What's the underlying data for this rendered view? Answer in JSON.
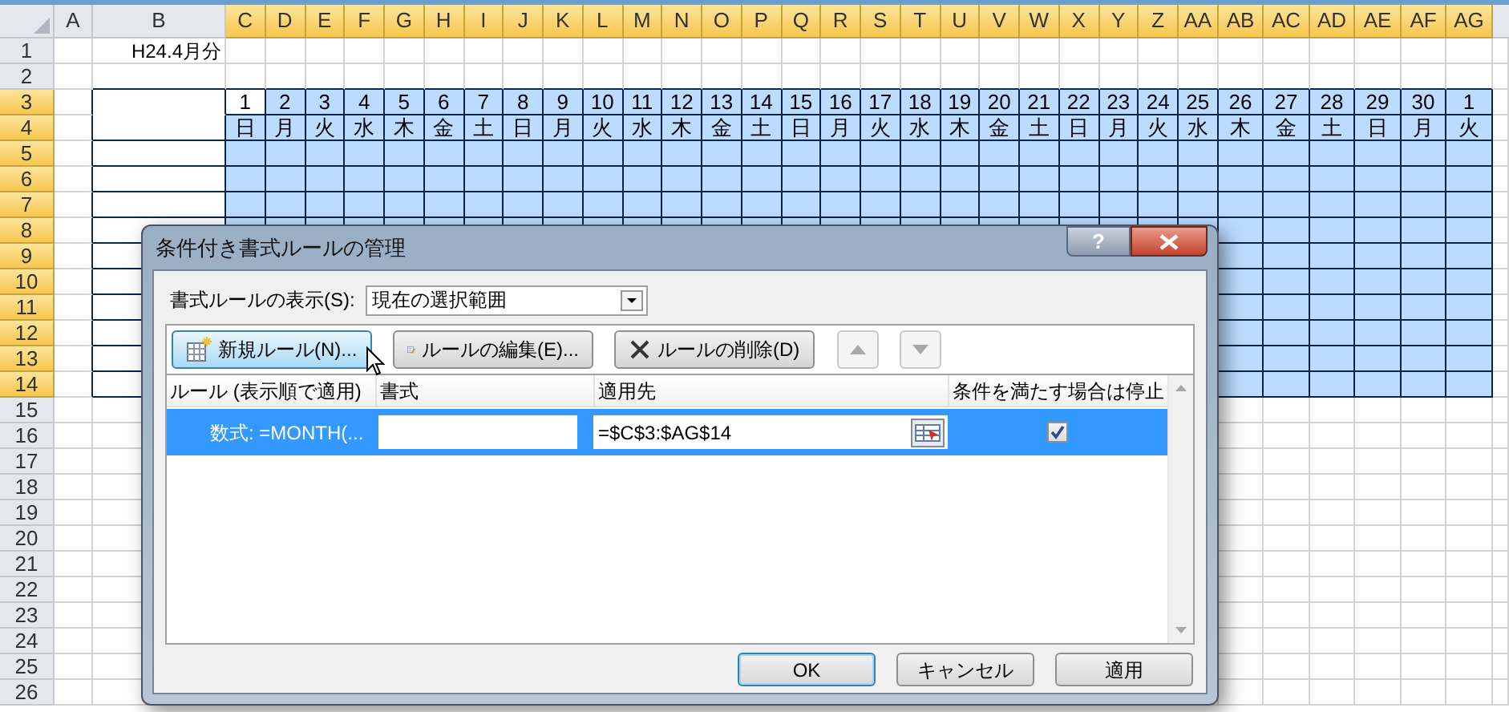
{
  "sheet": {
    "columns": [
      {
        "label": "A",
        "selected": false
      },
      {
        "label": "B",
        "selected": false
      },
      {
        "label": "C",
        "selected": true
      },
      {
        "label": "D",
        "selected": true
      },
      {
        "label": "E",
        "selected": true
      },
      {
        "label": "F",
        "selected": true
      },
      {
        "label": "G",
        "selected": true
      },
      {
        "label": "H",
        "selected": true
      },
      {
        "label": "I",
        "selected": true
      },
      {
        "label": "J",
        "selected": true
      },
      {
        "label": "K",
        "selected": true
      },
      {
        "label": "L",
        "selected": true
      },
      {
        "label": "M",
        "selected": true
      },
      {
        "label": "N",
        "selected": true
      },
      {
        "label": "O",
        "selected": true
      },
      {
        "label": "P",
        "selected": true
      },
      {
        "label": "Q",
        "selected": true
      },
      {
        "label": "R",
        "selected": true
      },
      {
        "label": "S",
        "selected": true
      },
      {
        "label": "T",
        "selected": true
      },
      {
        "label": "U",
        "selected": true
      },
      {
        "label": "V",
        "selected": true
      },
      {
        "label": "W",
        "selected": true
      },
      {
        "label": "X",
        "selected": true
      },
      {
        "label": "Y",
        "selected": true
      },
      {
        "label": "Z",
        "selected": true
      },
      {
        "label": "AA",
        "selected": true
      },
      {
        "label": "AB",
        "selected": true
      },
      {
        "label": "AC",
        "selected": true
      },
      {
        "label": "AD",
        "selected": true
      },
      {
        "label": "AE",
        "selected": true
      },
      {
        "label": "AF",
        "selected": true
      },
      {
        "label": "AG",
        "selected": true
      }
    ],
    "rows": [
      {
        "label": "1",
        "selected": false
      },
      {
        "label": "2",
        "selected": false
      },
      {
        "label": "3",
        "selected": true
      },
      {
        "label": "4",
        "selected": true
      },
      {
        "label": "5",
        "selected": true
      },
      {
        "label": "6",
        "selected": true
      },
      {
        "label": "7",
        "selected": true
      },
      {
        "label": "8",
        "selected": true
      },
      {
        "label": "9",
        "selected": true
      },
      {
        "label": "10",
        "selected": true
      },
      {
        "label": "11",
        "selected": true
      },
      {
        "label": "12",
        "selected": true
      },
      {
        "label": "13",
        "selected": true
      },
      {
        "label": "14",
        "selected": true
      },
      {
        "label": "15",
        "selected": false
      },
      {
        "label": "16",
        "selected": false
      },
      {
        "label": "17",
        "selected": false
      },
      {
        "label": "18",
        "selected": false
      },
      {
        "label": "19",
        "selected": false
      },
      {
        "label": "20",
        "selected": false
      },
      {
        "label": "21",
        "selected": false
      },
      {
        "label": "22",
        "selected": false
      },
      {
        "label": "23",
        "selected": false
      },
      {
        "label": "24",
        "selected": false
      },
      {
        "label": "25",
        "selected": false
      },
      {
        "label": "26",
        "selected": false
      }
    ],
    "title_cell": "H24.4月分",
    "dates": [
      {
        "day": "1",
        "weekday": "日",
        "active": true
      },
      {
        "day": "2",
        "weekday": "月",
        "active": false
      },
      {
        "day": "3",
        "weekday": "火",
        "active": false
      },
      {
        "day": "4",
        "weekday": "水",
        "active": false
      },
      {
        "day": "5",
        "weekday": "木",
        "active": false
      },
      {
        "day": "6",
        "weekday": "金",
        "active": false
      },
      {
        "day": "7",
        "weekday": "土",
        "active": false
      },
      {
        "day": "8",
        "weekday": "日",
        "active": false
      },
      {
        "day": "9",
        "weekday": "月",
        "active": false
      },
      {
        "day": "10",
        "weekday": "火",
        "active": false
      },
      {
        "day": "11",
        "weekday": "水",
        "active": false
      },
      {
        "day": "12",
        "weekday": "木",
        "active": false
      },
      {
        "day": "13",
        "weekday": "金",
        "active": false
      },
      {
        "day": "14",
        "weekday": "土",
        "active": false
      },
      {
        "day": "15",
        "weekday": "日",
        "active": false
      },
      {
        "day": "16",
        "weekday": "月",
        "active": false
      },
      {
        "day": "17",
        "weekday": "火",
        "active": false
      },
      {
        "day": "18",
        "weekday": "水",
        "active": false
      },
      {
        "day": "19",
        "weekday": "木",
        "active": false
      },
      {
        "day": "20",
        "weekday": "金",
        "active": false
      },
      {
        "day": "21",
        "weekday": "土",
        "active": false
      },
      {
        "day": "22",
        "weekday": "日",
        "active": false
      },
      {
        "day": "23",
        "weekday": "月",
        "active": false
      },
      {
        "day": "24",
        "weekday": "火",
        "active": false
      },
      {
        "day": "25",
        "weekday": "水",
        "active": false
      },
      {
        "day": "26",
        "weekday": "木",
        "active": false
      },
      {
        "day": "27",
        "weekday": "金",
        "active": false
      },
      {
        "day": "28",
        "weekday": "土",
        "active": false
      },
      {
        "day": "29",
        "weekday": "日",
        "active": false
      },
      {
        "day": "30",
        "weekday": "月",
        "active": false
      },
      {
        "day": "1",
        "weekday": "火",
        "active": false
      }
    ]
  },
  "dialog": {
    "title": "条件付き書式ルールの管理",
    "help_button": "?",
    "show_label": "書式ルールの表示(S):",
    "show_value": "現在の選択範囲",
    "toolbar": [
      {
        "kind": "new",
        "label": "新規ルール(N)...",
        "hovered": true
      },
      {
        "kind": "edit",
        "label": "ルールの編集(E)...",
        "hovered": false
      },
      {
        "kind": "delete",
        "label": "ルールの削除(D)",
        "hovered": false
      }
    ],
    "move_up": {
      "disabled": true
    },
    "move_down": {
      "disabled": true
    },
    "columns": [
      "ルール (表示順で適用)",
      "書式",
      "適用先",
      "条件を満たす場合は停止"
    ],
    "rules": [
      {
        "rule": "数式: =MONTH(...",
        "applies_to": "=$C$3:$AG$14",
        "stop": true,
        "selected": true
      }
    ],
    "buttons": [
      {
        "label": "OK",
        "default": true
      },
      {
        "label": "キャンセル",
        "default": false
      },
      {
        "label": "適用",
        "default": false
      }
    ]
  }
}
